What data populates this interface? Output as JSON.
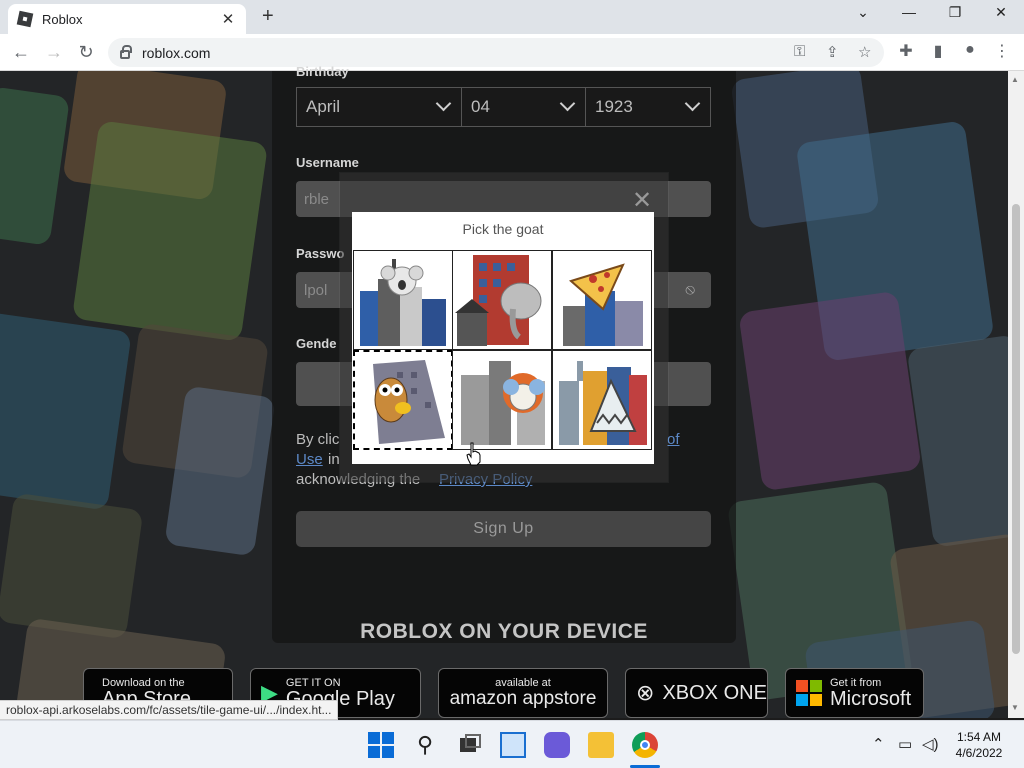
{
  "browser": {
    "tab_title": "Roblox",
    "url": "roblox.com",
    "status_url": "roblox-api.arkoselabs.com/fc/assets/tile-game-ui/.../index.ht..."
  },
  "signup": {
    "birthday_label": "Birthday",
    "month": "April",
    "day": "04",
    "year": "1923",
    "username_label": "Username",
    "username_value": "rble",
    "password_label": "Passwo",
    "password_value": "lpol",
    "gender_label": "Gende",
    "legal_prefix": "By clic",
    "legal_link_of": "of",
    "legal_link_use": "Use",
    "legal_in": "in",
    "legal_acknowledging": "acknowledging the",
    "legal_link_privacy": "Privacy Policy",
    "signup_button": "Sign Up"
  },
  "devices": {
    "title": "ROBLOX ON YOUR DEVICE",
    "app_store_small": "Download on the",
    "app_store_big": "App Store",
    "google_play_small": "GET IT ON",
    "google_play_big": "Google Play",
    "amazon_small": "available at",
    "amazon_big": "amazon appstore",
    "xbox": "XBOX ONE",
    "microsoft_small": "Get it from",
    "microsoft_big": "Microsoft"
  },
  "captcha": {
    "prompt": "Pick the goat",
    "tiles": [
      {
        "animal": "koala",
        "selected": false
      },
      {
        "animal": "elephant",
        "selected": false
      },
      {
        "animal": "pizza",
        "selected": false
      },
      {
        "animal": "owl",
        "selected": true
      },
      {
        "animal": "ram",
        "selected": false
      },
      {
        "animal": "shark",
        "selected": false
      }
    ]
  },
  "taskbar": {
    "time": "1:54 AM",
    "date": "4/6/2022"
  },
  "colors": {
    "link_blue": "#5c88c6",
    "chrome_bg": "#dfe3e8"
  }
}
